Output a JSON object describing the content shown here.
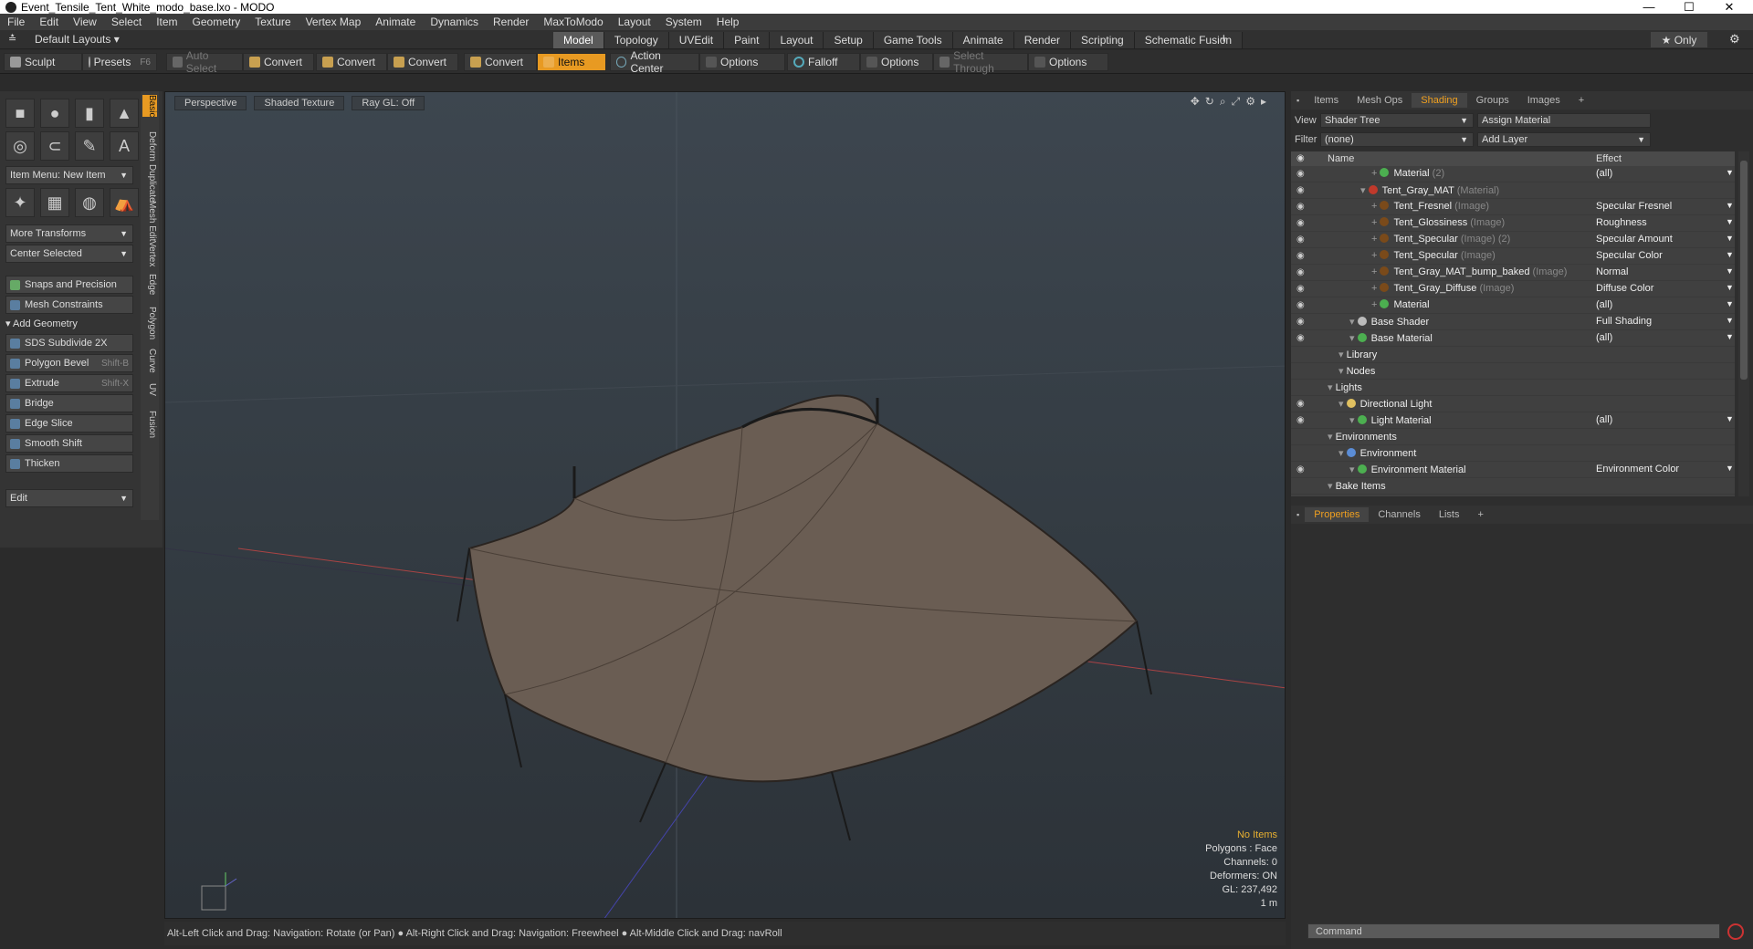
{
  "window": {
    "title": "Event_Tensile_Tent_White_modo_base.lxo - MODO",
    "min": "—",
    "max": "☐",
    "close": "✕"
  },
  "menu": [
    "File",
    "Edit",
    "View",
    "Select",
    "Item",
    "Geometry",
    "Texture",
    "Vertex Map",
    "Animate",
    "Dynamics",
    "Render",
    "MaxToModo",
    "Layout",
    "System",
    "Help"
  ],
  "layouts": {
    "current": "Default Layouts ▾",
    "tabs": [
      "Model",
      "Topology",
      "UVEdit",
      "Paint",
      "Layout",
      "Setup",
      "Game Tools",
      "Animate",
      "Render",
      "Scripting",
      "Schematic Fusion"
    ],
    "active": "Model",
    "add": "+",
    "only": "★  Only"
  },
  "toolbar": {
    "sculpt": "Sculpt",
    "presets": "Presets",
    "presets_key": "F6",
    "auto_select": "Auto Select",
    "convert": "Convert",
    "items": "Items",
    "action_center": "Action Center",
    "options": "Options",
    "falloff": "Falloff",
    "select_through": "Select Through"
  },
  "left": {
    "item_menu": "Item Menu: New Item",
    "more_transforms": "More Transforms",
    "center_selected": "Center Selected",
    "snaps": "Snaps and Precision",
    "mesh_constraints": "Mesh Constraints",
    "add_geometry": "Add Geometry",
    "tools": [
      {
        "label": "SDS Subdivide 2X",
        "key": ""
      },
      {
        "label": "Polygon Bevel",
        "key": "Shift-B"
      },
      {
        "label": "Extrude",
        "key": "Shift-X"
      },
      {
        "label": "Bridge",
        "key": ""
      },
      {
        "label": "Edge Slice",
        "key": ""
      },
      {
        "label": "Smooth Shift",
        "key": ""
      },
      {
        "label": "Thicken",
        "key": ""
      }
    ],
    "edit": "Edit",
    "vtabs": [
      "Basic",
      "Deform",
      "Duplicate",
      "Mesh Edit",
      "Vertex",
      "Edge",
      "Polygon",
      "Curve",
      "UV",
      "Fusion"
    ]
  },
  "viewport": {
    "perspective": "Perspective",
    "shading": "Shaded Texture",
    "raygl": "Ray GL: Off",
    "stats": {
      "items": "No Items",
      "polygons": "Polygons : Face",
      "channels": "Channels: 0",
      "deformers": "Deformers: ON",
      "gl": "GL: 237,492",
      "scale": "1 m"
    }
  },
  "status": "Alt-Left Click and Drag: Navigation: Rotate (or Pan) ● Alt-Right Click and Drag: Navigation: Freewheel ● Alt-Middle Click and Drag: navRoll",
  "right": {
    "tabs": [
      "Items",
      "Mesh Ops",
      "Shading",
      "Groups",
      "Images"
    ],
    "active_tab": "Shading",
    "view_label": "View",
    "view_value": "Shader Tree",
    "assign": "Assign Material",
    "filter_label": "Filter",
    "filter_value": "(none)",
    "add_layer": "Add Layer",
    "col_name": "Name",
    "col_effect": "Effect",
    "rows": [
      {
        "eye": true,
        "indent": 5,
        "name": "Material",
        "type": "(2)",
        "effect": "(all)",
        "color": "#4caf50"
      },
      {
        "eye": true,
        "indent": 4,
        "name": "Tent_Gray_MAT",
        "type": "(Material)",
        "effect": "",
        "color": "#c0392b"
      },
      {
        "eye": true,
        "indent": 5,
        "name": "Tent_Fresnel",
        "type": "(Image)",
        "effect": "Specular Fresnel",
        "color": "#7a4a1a"
      },
      {
        "eye": true,
        "indent": 5,
        "name": "Tent_Glossiness",
        "type": "(Image)",
        "effect": "Roughness",
        "color": "#7a4a1a"
      },
      {
        "eye": true,
        "indent": 5,
        "name": "Tent_Specular",
        "type": "(Image) (2)",
        "effect": "Specular Amount",
        "color": "#7a4a1a"
      },
      {
        "eye": true,
        "indent": 5,
        "name": "Tent_Specular",
        "type": "(Image)",
        "effect": "Specular Color",
        "color": "#7a4a1a"
      },
      {
        "eye": true,
        "indent": 5,
        "name": "Tent_Gray_MAT_bump_baked",
        "type": "(Image)",
        "effect": "Normal",
        "color": "#7a4a1a"
      },
      {
        "eye": true,
        "indent": 5,
        "name": "Tent_Gray_Diffuse",
        "type": "(Image)",
        "effect": "Diffuse Color",
        "color": "#7a4a1a"
      },
      {
        "eye": true,
        "indent": 5,
        "name": "Material",
        "type": "",
        "effect": "(all)",
        "color": "#4caf50"
      },
      {
        "eye": true,
        "indent": 3,
        "name": "Base Shader",
        "type": "",
        "effect": "Full Shading",
        "color": "#bbbbbb"
      },
      {
        "eye": true,
        "indent": 3,
        "name": "Base Material",
        "type": "",
        "effect": "(all)",
        "color": "#4caf50"
      },
      {
        "eye": false,
        "indent": 2,
        "name": "Library",
        "type": "",
        "effect": "",
        "color": ""
      },
      {
        "eye": false,
        "indent": 2,
        "name": "Nodes",
        "type": "",
        "effect": "",
        "color": ""
      },
      {
        "eye": false,
        "indent": 1,
        "name": "Lights",
        "type": "",
        "effect": "",
        "color": ""
      },
      {
        "eye": true,
        "indent": 2,
        "name": "Directional Light",
        "type": "",
        "effect": "",
        "color": "#e0c060"
      },
      {
        "eye": true,
        "indent": 3,
        "name": "Light Material",
        "type": "",
        "effect": "(all)",
        "color": "#4caf50"
      },
      {
        "eye": false,
        "indent": 1,
        "name": "Environments",
        "type": "",
        "effect": "",
        "color": ""
      },
      {
        "eye": false,
        "indent": 2,
        "name": "Environment",
        "type": "",
        "effect": "",
        "color": "#5b8dd6"
      },
      {
        "eye": true,
        "indent": 3,
        "name": "Environment Material",
        "type": "",
        "effect": "Environment Color",
        "color": "#4caf50"
      },
      {
        "eye": false,
        "indent": 1,
        "name": "Bake Items",
        "type": "",
        "effect": "",
        "color": ""
      }
    ],
    "prop_tabs": [
      "Properties",
      "Channels",
      "Lists"
    ],
    "prop_active": "Properties",
    "command_placeholder": "Command"
  },
  "colors": {
    "accent": "#e89a22"
  }
}
